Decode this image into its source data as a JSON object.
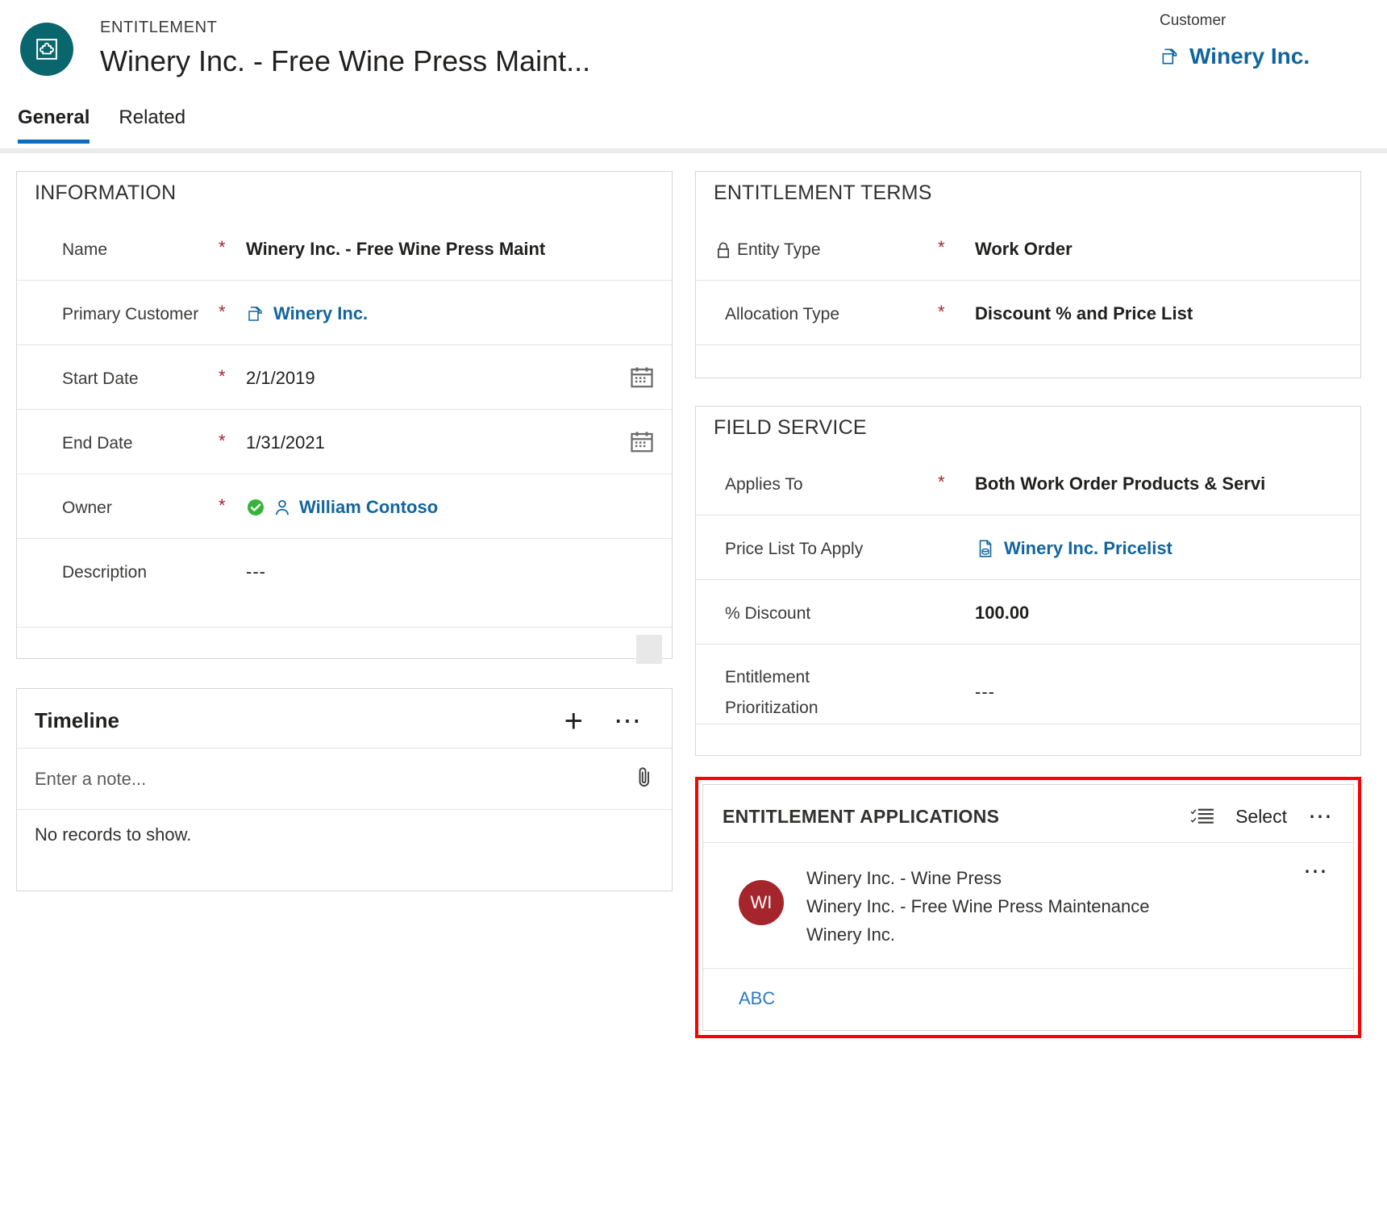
{
  "header": {
    "eyebrow": "ENTITLEMENT",
    "title": "Winery Inc. - Free Wine Press Maint...",
    "entity_icon": "entitlement-icon",
    "accent_teal": "#08666c",
    "customer_label": "Customer",
    "customer_value": "Winery Inc.",
    "customer_icon": "account-icon"
  },
  "tabs": [
    {
      "label": "General",
      "active": true
    },
    {
      "label": "Related",
      "active": false
    }
  ],
  "information": {
    "section_title": "INFORMATION",
    "fields": [
      {
        "label": "Name",
        "required": "*",
        "value": "Winery Inc. - Free Wine Press Maint",
        "kind": "text"
      },
      {
        "label": "Primary Customer",
        "required": "*",
        "value": "Winery Inc.",
        "kind": "link",
        "icon": "account-icon"
      },
      {
        "label": "Start Date",
        "required": "*",
        "value": "2/1/2019",
        "kind": "date",
        "trailing_icon": "calendar-icon"
      },
      {
        "label": "End Date",
        "required": "*",
        "value": "1/31/2021",
        "kind": "date",
        "trailing_icon": "calendar-icon"
      },
      {
        "label": "Owner",
        "required": "*",
        "value": "William Contoso",
        "kind": "link",
        "icon": "user-icon",
        "status_icon": "check-circle-icon"
      },
      {
        "label": "Description",
        "required": "",
        "value": "---",
        "kind": "empty"
      }
    ]
  },
  "timeline": {
    "title": "Timeline",
    "add_icon": "plus-icon",
    "more_icon": "ellipsis-icon",
    "note_placeholder": "Enter a note...",
    "attach_icon": "paperclip-icon",
    "empty_text": "No records to show."
  },
  "entitlement_terms": {
    "section_title": "ENTITLEMENT TERMS",
    "fields": [
      {
        "label": "Entity Type",
        "required": "*",
        "value": "Work Order",
        "lock_icon": "lock-icon"
      },
      {
        "label": "Allocation Type",
        "required": "*",
        "value": "Discount % and Price List"
      }
    ]
  },
  "field_service": {
    "section_title": "FIELD SERVICE",
    "fields": [
      {
        "label": "Applies To",
        "required": "*",
        "value": "Both Work Order Products & Servi",
        "kind": "text"
      },
      {
        "label": "Price List To Apply",
        "required": "",
        "value": "Winery Inc. Pricelist",
        "kind": "link",
        "icon": "pricelist-icon"
      },
      {
        "label": "% Discount",
        "required": "",
        "value": "100.00",
        "kind": "text"
      },
      {
        "label": "Entitlement Prioritization",
        "required": "",
        "value": "---",
        "kind": "empty"
      }
    ]
  },
  "entitlement_applications": {
    "section_title": "ENTITLEMENT APPLICATIONS",
    "highlight_color": "#ff0000",
    "select_icon": "checklist-icon",
    "select_label": "Select",
    "more_icon": "ellipsis-icon",
    "items": [
      {
        "avatar_initials": "WI",
        "avatar_color": "#a4262c",
        "line1": "Winery Inc. - Wine Press",
        "line2": "Winery Inc. - Free Wine Press Maintenance",
        "line3": "Winery Inc.",
        "row_more_icon": "ellipsis-icon"
      }
    ],
    "footer_link": "ABC"
  }
}
